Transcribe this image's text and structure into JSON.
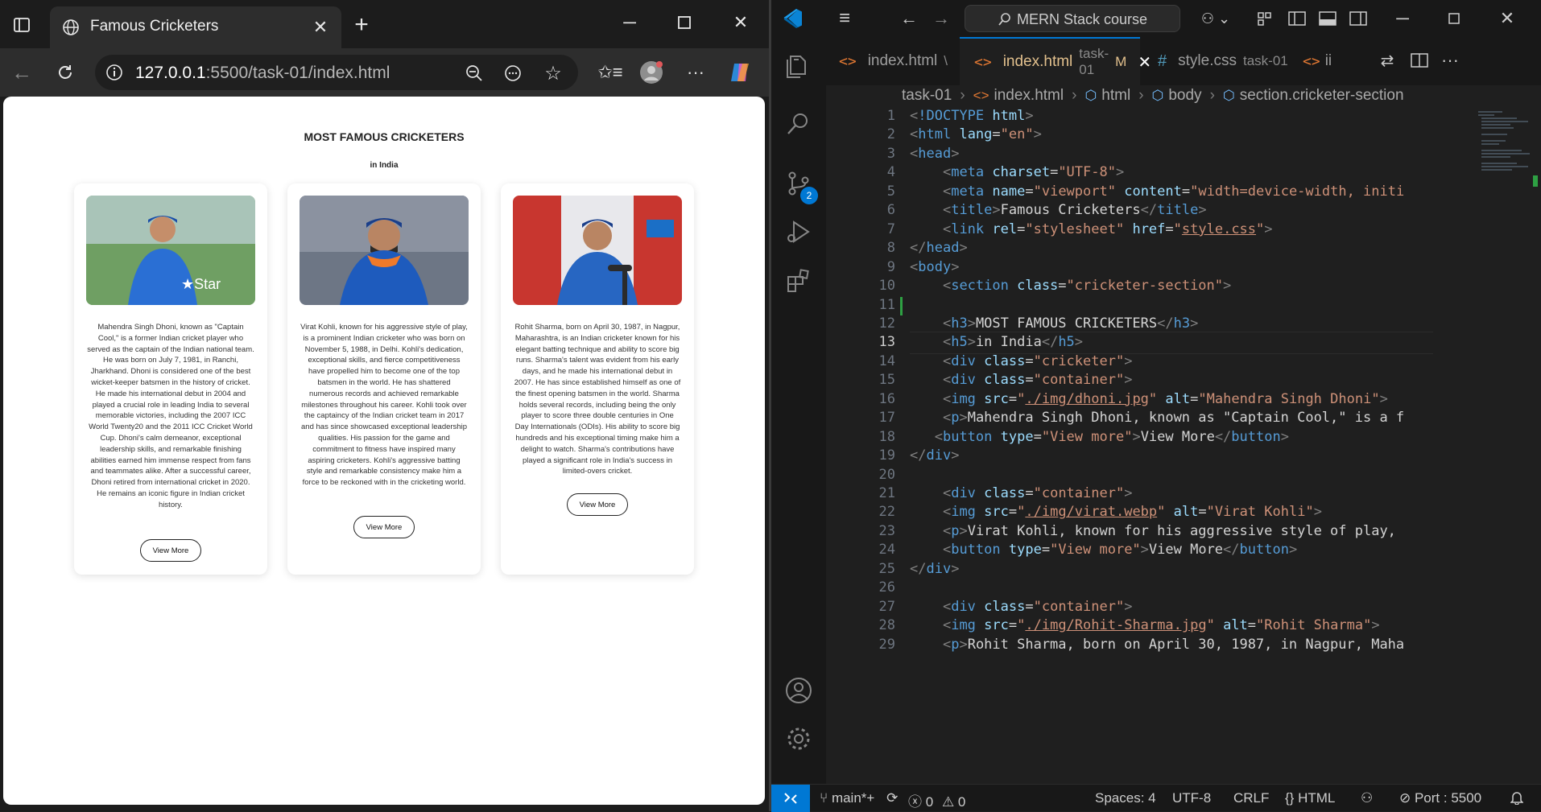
{
  "browser": {
    "tab_title": "Famous Cricketers",
    "url_host": "127.0.0.1",
    "url_path": ":5500/task-01/index.html"
  },
  "page": {
    "heading": "MOST FAMOUS CRICKETERS",
    "subheading": "in India",
    "cards": [
      {
        "alt": "Mahendra Singh Dhoni",
        "text": "Mahendra Singh Dhoni, known as \"Captain Cool,\" is a former Indian cricket player who served as the captain of the Indian national team. He was born on July 7, 1981, in Ranchi, Jharkhand. Dhoni is considered one of the best wicket-keeper batsmen in the history of cricket. He made his international debut in 2004 and played a crucial role in leading India to several memorable victories, including the 2007 ICC World Twenty20 and the 2011 ICC Cricket World Cup. Dhoni's calm demeanor, exceptional leadership skills, and remarkable finishing abilities earned him immense respect from fans and teammates alike. After a successful career, Dhoni retired from international cricket in 2020. He remains an iconic figure in Indian cricket history.",
        "button": "View More"
      },
      {
        "alt": "Virat Kohli",
        "text": "Virat Kohli, known for his aggressive style of play, is a prominent Indian cricketer who was born on November 5, 1988, in Delhi. Kohli's dedication, exceptional skills, and fierce competitiveness have propelled him to become one of the top batsmen in the world. He has shattered numerous records and achieved remarkable milestones throughout his career. Kohli took over the captaincy of the Indian cricket team in 2017 and has since showcased exceptional leadership qualities. His passion for the game and commitment to fitness have inspired many aspiring cricketers. Kohli's aggressive batting style and remarkable consistency make him a force to be reckoned with in the cricketing world.",
        "button": "View More"
      },
      {
        "alt": "Rohit Sharma",
        "text": "Rohit Sharma, born on April 30, 1987, in Nagpur, Maharashtra, is an Indian cricketer known for his elegant batting technique and ability to score big runs. Sharma's talent was evident from his early days, and he made his international debut in 2007. He has since established himself as one of the finest opening batsmen in the world. Sharma holds several records, including being the only player to score three double centuries in One Day Internationals (ODIs). His ability to score big hundreds and his exceptional timing make him a delight to watch. Sharma's contributions have played a significant role in India's success in limited-overs cricket.",
        "button": "View More"
      }
    ]
  },
  "vscode": {
    "command_center": "MERN Stack course",
    "tabs": [
      {
        "name": "index.html",
        "sub": "\\",
        "active": false
      },
      {
        "name": "index.html",
        "sub": "task-01",
        "modified": "M",
        "active": true
      },
      {
        "name": "style.css",
        "sub": "task-01",
        "active": false
      },
      {
        "name": "ii",
        "active": false
      }
    ],
    "breadcrumb": [
      "task-01",
      "index.html",
      "html",
      "body",
      "section.cricketer-section"
    ],
    "scm_badge": "2",
    "current_line": 13,
    "line_numbers": [
      "1",
      "2",
      "3",
      "4",
      "5",
      "6",
      "7",
      "8",
      "9",
      "10",
      "11",
      "12",
      "13",
      "14",
      "15",
      "16",
      "17",
      "18",
      "19",
      "20",
      "21",
      "22",
      "23",
      "24",
      "25",
      "26",
      "27",
      "28",
      "29"
    ],
    "code_lines": [
      "<!DOCTYPE html>",
      "<html lang=\"en\">",
      "<head>",
      "    <meta charset=\"UTF-8\">",
      "    <meta name=\"viewport\" content=\"width=device-width, initi",
      "    <title>Famous Cricketers</title>",
      "    <link rel=\"stylesheet\" href=\"style.css\">",
      "</head>",
      "<body>",
      "    <section class=\"cricketer-section\">",
      "",
      "    <h3>MOST FAMOUS CRICKETERS</h3>",
      "    <h5>in India</h5>",
      "    <div class=\"cricketer\">",
      "    <div class=\"container\">",
      "    <img src=\"./img/dhoni.jpg\" alt=\"Mahendra Singh Dhoni\">",
      "    <p>Mahendra Singh Dhoni, known as \"Captain Cool,\" is a f",
      "   <button type=\"View more\">View More</button>",
      "</div>",
      "",
      "    <div class=\"container\">",
      "    <img src=\"./img/virat.webp\" alt=\"Virat Kohli\">",
      "    <p>Virat Kohli, known for his aggressive style of play,",
      "    <button type=\"View more\">View More</button>",
      "</div>",
      "",
      "    <div class=\"container\">",
      "    <img src=\"./img/Rohit-Sharma.jpg\" alt=\"Rohit Sharma\">",
      "    <p>Rohit Sharma, born on April 30, 1987, in Nagpur, Maha"
    ],
    "status": {
      "branch": "main*+",
      "errors": "0",
      "warnings": "0",
      "spaces": "Spaces: 4",
      "encoding": "UTF-8",
      "eol": "CRLF",
      "language": "HTML",
      "port": "Port : 5500"
    }
  },
  "colors": {
    "accent": "#0078d4",
    "tag": "#569cd6",
    "attr": "#9cdcfe",
    "string": "#ce9178"
  }
}
